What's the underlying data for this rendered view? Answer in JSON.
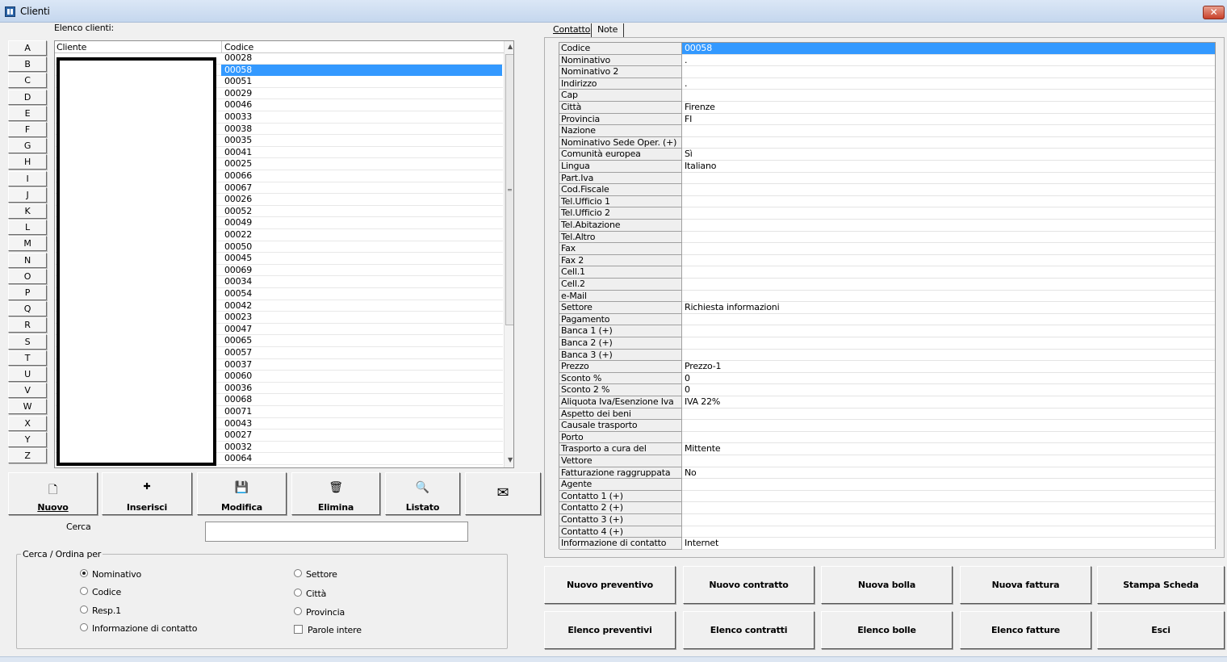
{
  "window": {
    "title": "Clienti",
    "close_label": "✕"
  },
  "list": {
    "label": "Elenco clienti:",
    "col_cliente": "Cliente",
    "col_codice": "Codice",
    "selected_index": 1,
    "codes": [
      "00028",
      "00058",
      "00051",
      "00029",
      "00046",
      "00033",
      "00038",
      "00035",
      "00041",
      "00025",
      "00066",
      "00067",
      "00026",
      "00052",
      "00049",
      "00022",
      "00050",
      "00045",
      "00069",
      "00034",
      "00054",
      "00042",
      "00023",
      "00047",
      "00065",
      "00057",
      "00037",
      "00060",
      "00036",
      "00068",
      "00071",
      "00043",
      "00027",
      "00032",
      "00064"
    ]
  },
  "letters": [
    "A",
    "B",
    "C",
    "D",
    "E",
    "F",
    "G",
    "H",
    "I",
    "J",
    "K",
    "L",
    "M",
    "N",
    "O",
    "P",
    "Q",
    "R",
    "S",
    "T",
    "U",
    "V",
    "W",
    "X",
    "Y",
    "Z"
  ],
  "toolbar": {
    "nuovo": "Nuovo",
    "inserisci": "Inserisci",
    "modifica": "Modifica",
    "elimina": "Elimina",
    "listato": "Listato"
  },
  "search": {
    "label": "Cerca",
    "value": ""
  },
  "sort_group": {
    "title": "Cerca / Ordina per",
    "options": [
      "Nominativo",
      "Codice",
      "Resp.1",
      "Informazione di contatto",
      "Settore",
      "Città",
      "Provincia"
    ],
    "selected": "Nominativo",
    "parole_intere": "Parole intere"
  },
  "tabs": [
    "Contatto",
    "Note"
  ],
  "details": [
    {
      "label": "Codice",
      "value": "00058"
    },
    {
      "label": "Nominativo",
      "value": "."
    },
    {
      "label": "Nominativo 2",
      "value": ""
    },
    {
      "label": "Indirizzo",
      "value": "."
    },
    {
      "label": "Cap",
      "value": ""
    },
    {
      "label": "Città",
      "value": "Firenze"
    },
    {
      "label": "Provincia",
      "value": "FI"
    },
    {
      "label": "Nazione",
      "value": ""
    },
    {
      "label": "Nominativo Sede Oper. (+)",
      "value": ""
    },
    {
      "label": "Comunità europea",
      "value": "Sì"
    },
    {
      "label": "Lingua",
      "value": "Italiano"
    },
    {
      "label": "Part.Iva",
      "value": ""
    },
    {
      "label": "Cod.Fiscale",
      "value": ""
    },
    {
      "label": "Tel.Ufficio 1",
      "value": ""
    },
    {
      "label": "Tel.Ufficio 2",
      "value": ""
    },
    {
      "label": "Tel.Abitazione",
      "value": ""
    },
    {
      "label": "Tel.Altro",
      "value": ""
    },
    {
      "label": "Fax",
      "value": ""
    },
    {
      "label": "Fax 2",
      "value": ""
    },
    {
      "label": "Cell.1",
      "value": ""
    },
    {
      "label": "Cell.2",
      "value": ""
    },
    {
      "label": "e-Mail",
      "value": ""
    },
    {
      "label": "Settore",
      "value": "Richiesta informazioni"
    },
    {
      "label": "Pagamento",
      "value": ""
    },
    {
      "label": "Banca 1  (+)",
      "value": ""
    },
    {
      "label": "Banca 2  (+)",
      "value": ""
    },
    {
      "label": "Banca 3  (+)",
      "value": ""
    },
    {
      "label": "Prezzo",
      "value": "Prezzo-1"
    },
    {
      "label": "Sconto %",
      "value": "0"
    },
    {
      "label": "Sconto 2 %",
      "value": "0"
    },
    {
      "label": "Aliquota Iva/Esenzione Iva",
      "value": "IVA 22%"
    },
    {
      "label": "Aspetto dei beni",
      "value": ""
    },
    {
      "label": "Causale trasporto",
      "value": ""
    },
    {
      "label": "Porto",
      "value": ""
    },
    {
      "label": "Trasporto a cura del",
      "value": "Mittente"
    },
    {
      "label": "Vettore",
      "value": ""
    },
    {
      "label": "Fatturazione raggruppata",
      "value": "No"
    },
    {
      "label": "Agente",
      "value": ""
    },
    {
      "label": "Contatto 1  (+)",
      "value": ""
    },
    {
      "label": "Contatto 2  (+)",
      "value": ""
    },
    {
      "label": "Contatto 3  (+)",
      "value": ""
    },
    {
      "label": "Contatto 4  (+)",
      "value": ""
    },
    {
      "label": "Informazione di contatto",
      "value": "Internet"
    }
  ],
  "actions_row1": [
    "Nuovo preventivo",
    "Nuovo contratto",
    "Nuova bolla",
    "Nuova fattura",
    "Stampa Scheda"
  ],
  "actions_row2": [
    "Elenco preventivi",
    "Elenco contratti",
    "Elenco bolle",
    "Elenco fatture",
    "Esci"
  ]
}
